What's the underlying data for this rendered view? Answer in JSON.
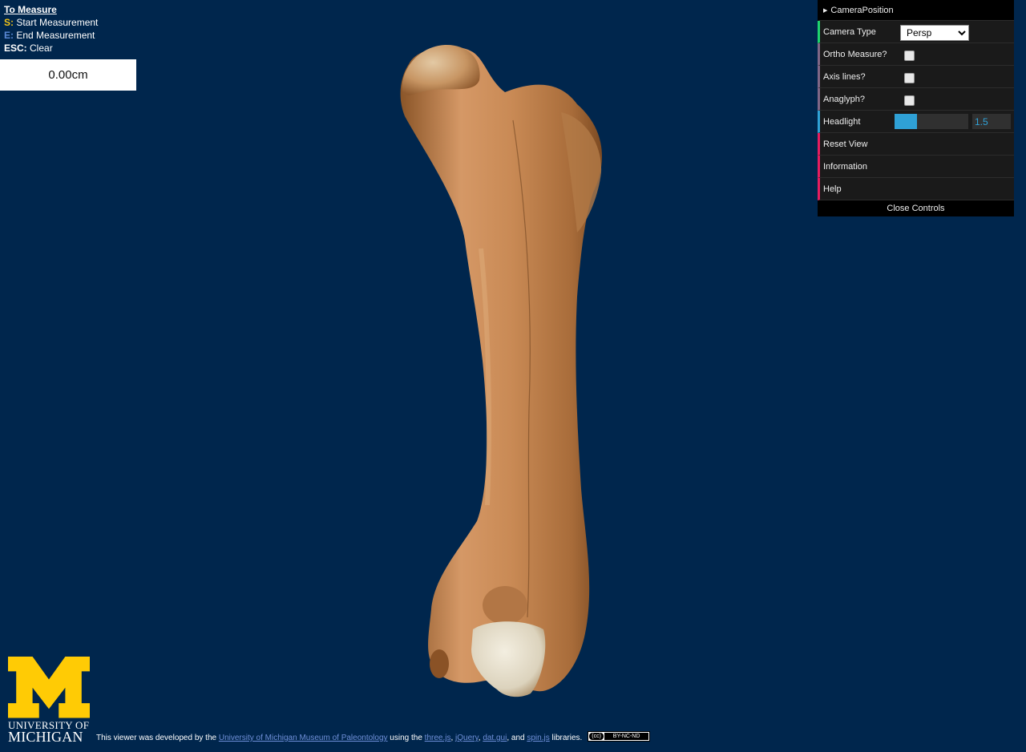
{
  "measure": {
    "title": "To Measure",
    "start_key": "S:",
    "start_label": "Start Measurement",
    "end_key": "E:",
    "end_label": "End Measurement",
    "clear_key": "ESC:",
    "clear_label": "Clear",
    "value": "0.00cm"
  },
  "gui": {
    "folder": "CameraPosition",
    "camera_type_label": "Camera Type",
    "camera_type_value": "Persp",
    "ortho_label": "Ortho Measure?",
    "axis_label": "Axis lines?",
    "anaglyph_label": "Anaglyph?",
    "headlight_label": "Headlight",
    "headlight_value": "1.5",
    "headlight_fraction": 0.3,
    "reset_label": "Reset View",
    "info_label": "Information",
    "help_label": "Help",
    "close_label": "Close Controls"
  },
  "footer": {
    "univ_line1": "UNIVERSITY OF",
    "univ_line2": "MICHIGAN",
    "credit_prefix": "This viewer was developed by the",
    "museum_link": "University of Michigan Museum of Paleontology",
    "using": "using the",
    "lib1": "three.js",
    "lib2": "jQuery",
    "lib3": "dat.gui",
    "and": ", and",
    "lib4": "spin.js",
    "suffix": "libraries.",
    "license_cc": "(cc)",
    "license": "BY-NC-ND"
  },
  "colors": {
    "background": "#00264d",
    "maize": "#ffcb05",
    "bone": "#c98a55"
  }
}
